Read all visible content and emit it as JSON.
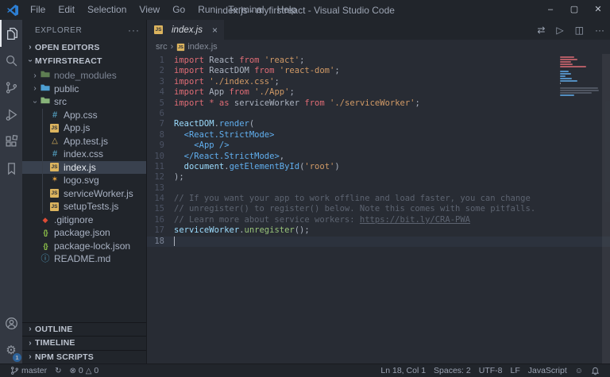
{
  "titlebar": {
    "title": "index.js - myfirstreact - Visual Studio Code",
    "menus": [
      "File",
      "Edit",
      "Selection",
      "View",
      "Go",
      "Run",
      "Terminal",
      "Help"
    ],
    "controls": {
      "minimize": "–",
      "maximize": "▢",
      "close": "✕"
    }
  },
  "activity_bar": {
    "items": [
      {
        "icon": "explorer-icon",
        "active": true
      },
      {
        "icon": "search-icon"
      },
      {
        "icon": "source-control-icon"
      },
      {
        "icon": "run-debug-icon"
      },
      {
        "icon": "extensions-icon"
      },
      {
        "icon": "bookmarks-icon"
      }
    ],
    "bottom": [
      {
        "icon": "accounts-icon"
      },
      {
        "icon": "settings-gear-icon",
        "badge": "1",
        "glyph": "⚙"
      }
    ]
  },
  "sidebar": {
    "title": "EXPLORER",
    "more_label": "···",
    "open_editors_label": "OPEN EDITORS",
    "root_label": "MYFIRSTREACT",
    "tree": [
      {
        "label": "node_modules",
        "icon": "folder",
        "color": "#5e7e52",
        "depth": 0,
        "chevron": "collapsed",
        "dim": true
      },
      {
        "label": "public",
        "icon": "folder",
        "color": "#4d9fd2",
        "depth": 0,
        "chevron": "collapsed"
      },
      {
        "label": "src",
        "icon": "folder",
        "color": "#87b379",
        "depth": 0,
        "chevron": "expanded"
      },
      {
        "label": "App.css",
        "icon": "css",
        "depth": 1
      },
      {
        "label": "App.js",
        "icon": "js",
        "depth": 1
      },
      {
        "label": "App.test.js",
        "icon": "test",
        "depth": 1
      },
      {
        "label": "index.css",
        "icon": "css",
        "depth": 1
      },
      {
        "label": "index.js",
        "icon": "js",
        "depth": 1,
        "selected": true
      },
      {
        "label": "logo.svg",
        "icon": "svg",
        "depth": 1
      },
      {
        "label": "serviceWorker.js",
        "icon": "js",
        "depth": 1
      },
      {
        "label": "setupTests.js",
        "icon": "js",
        "depth": 1
      },
      {
        "label": ".gitignore",
        "icon": "git",
        "depth": 0
      },
      {
        "label": "package.json",
        "icon": "npm",
        "depth": 0
      },
      {
        "label": "package-lock.json",
        "icon": "npm",
        "depth": 0
      },
      {
        "label": "README.md",
        "icon": "info",
        "depth": 0
      }
    ],
    "panels": [
      "OUTLINE",
      "TIMELINE",
      "NPM SCRIPTS"
    ]
  },
  "editor": {
    "tab": {
      "label": "index.js",
      "close": "×"
    },
    "actions": [
      {
        "name": "compare-changes-icon",
        "glyph": "⇄"
      },
      {
        "name": "run-file-icon",
        "glyph": "▷"
      },
      {
        "name": "split-editor-icon",
        "glyph": "◫"
      },
      {
        "name": "more-actions-icon",
        "glyph": "···"
      }
    ],
    "breadcrumb": {
      "items": [
        "src",
        "index.js"
      ],
      "separator": "›"
    },
    "active_line": 18,
    "code": [
      {
        "n": 1,
        "tokens": [
          [
            "kw",
            "import"
          ],
          [
            "pl",
            " React "
          ],
          [
            "kw",
            "from"
          ],
          [
            "pl",
            " "
          ],
          [
            "str",
            "'react'"
          ],
          [
            "pl",
            ";"
          ]
        ]
      },
      {
        "n": 2,
        "tokens": [
          [
            "kw",
            "import"
          ],
          [
            "pl",
            " ReactDOM "
          ],
          [
            "kw",
            "from"
          ],
          [
            "pl",
            " "
          ],
          [
            "str",
            "'react-dom'"
          ],
          [
            "pl",
            ";"
          ]
        ]
      },
      {
        "n": 3,
        "tokens": [
          [
            "kw",
            "import"
          ],
          [
            "pl",
            " "
          ],
          [
            "str",
            "'./index.css'"
          ],
          [
            "pl",
            ";"
          ]
        ]
      },
      {
        "n": 4,
        "tokens": [
          [
            "kw",
            "import"
          ],
          [
            "pl",
            " App "
          ],
          [
            "kw",
            "from"
          ],
          [
            "pl",
            " "
          ],
          [
            "str",
            "'./App'"
          ],
          [
            "pl",
            ";"
          ]
        ]
      },
      {
        "n": 5,
        "tokens": [
          [
            "kw",
            "import"
          ],
          [
            "pl",
            " "
          ],
          [
            "kw",
            "*"
          ],
          [
            "pl",
            " "
          ],
          [
            "kw",
            "as"
          ],
          [
            "pl",
            " serviceWorker "
          ],
          [
            "kw",
            "from"
          ],
          [
            "pl",
            " "
          ],
          [
            "str",
            "'./serviceWorker'"
          ],
          [
            "pl",
            ";"
          ]
        ]
      },
      {
        "n": 6,
        "tokens": []
      },
      {
        "n": 7,
        "tokens": [
          [
            "var",
            "ReactDOM"
          ],
          [
            "pl",
            "."
          ],
          [
            "fn",
            "render"
          ],
          [
            "pl",
            "("
          ]
        ]
      },
      {
        "n": 8,
        "tokens": [
          [
            "pl",
            "  "
          ],
          [
            "tag",
            "<React.StrictMode>"
          ]
        ]
      },
      {
        "n": 9,
        "tokens": [
          [
            "pl",
            "    "
          ],
          [
            "tag",
            "<App />"
          ]
        ]
      },
      {
        "n": 10,
        "tokens": [
          [
            "pl",
            "  "
          ],
          [
            "tag",
            "</React.StrictMode>"
          ],
          [
            "pl",
            ","
          ]
        ]
      },
      {
        "n": 11,
        "tokens": [
          [
            "pl",
            "  "
          ],
          [
            "var",
            "document"
          ],
          [
            "pl",
            "."
          ],
          [
            "fn",
            "getElementById"
          ],
          [
            "pl",
            "("
          ],
          [
            "str",
            "'root'"
          ],
          [
            "pl",
            ")"
          ]
        ]
      },
      {
        "n": 12,
        "tokens": [
          [
            "pl",
            ");"
          ]
        ]
      },
      {
        "n": 13,
        "tokens": []
      },
      {
        "n": 14,
        "tokens": [
          [
            "cmt",
            "// If you want your app to work offline and load faster, you can change"
          ]
        ]
      },
      {
        "n": 15,
        "tokens": [
          [
            "cmt",
            "// unregister() to register() below. Note this comes with some pitfalls."
          ]
        ]
      },
      {
        "n": 16,
        "tokens": [
          [
            "cmt",
            "// Learn more about service workers: "
          ],
          [
            "lnk",
            "https://bit.ly/CRA-PWA"
          ]
        ]
      },
      {
        "n": 17,
        "tokens": [
          [
            "var",
            "serviceWorker"
          ],
          [
            "pl",
            "."
          ],
          [
            "grn",
            "unregister"
          ],
          [
            "pl",
            "();"
          ]
        ]
      },
      {
        "n": 18,
        "tokens": []
      }
    ]
  },
  "status_bar": {
    "branch": "master",
    "errors": "0",
    "warnings": "0",
    "error_glyph": "⊗",
    "warning_glyph": "△",
    "sync_glyph": "↻",
    "feedback_glyph": "☺",
    "right": [
      "Ln 18, Col 1",
      "Spaces: 2",
      "UTF-8",
      "LF",
      "JavaScript"
    ]
  },
  "colors": {
    "titlebar_bg": "#21252b",
    "activitybar_bg": "#333842",
    "sidebar_bg": "#21252b",
    "editor_bg": "#282c34",
    "statusbar_bg": "#21252b",
    "accent_badge": "#2a7ed2",
    "keyword": "#e06c75",
    "string": "#d19a66",
    "plain": "#abb2bf",
    "variable": "#9cdcfe",
    "function": "#61afef",
    "jsx_tag": "#61afef",
    "method_green": "#98c379",
    "comment": "#5c6370",
    "selected_row_bg": "#39414e",
    "current_line_bg": "#2c323d"
  }
}
